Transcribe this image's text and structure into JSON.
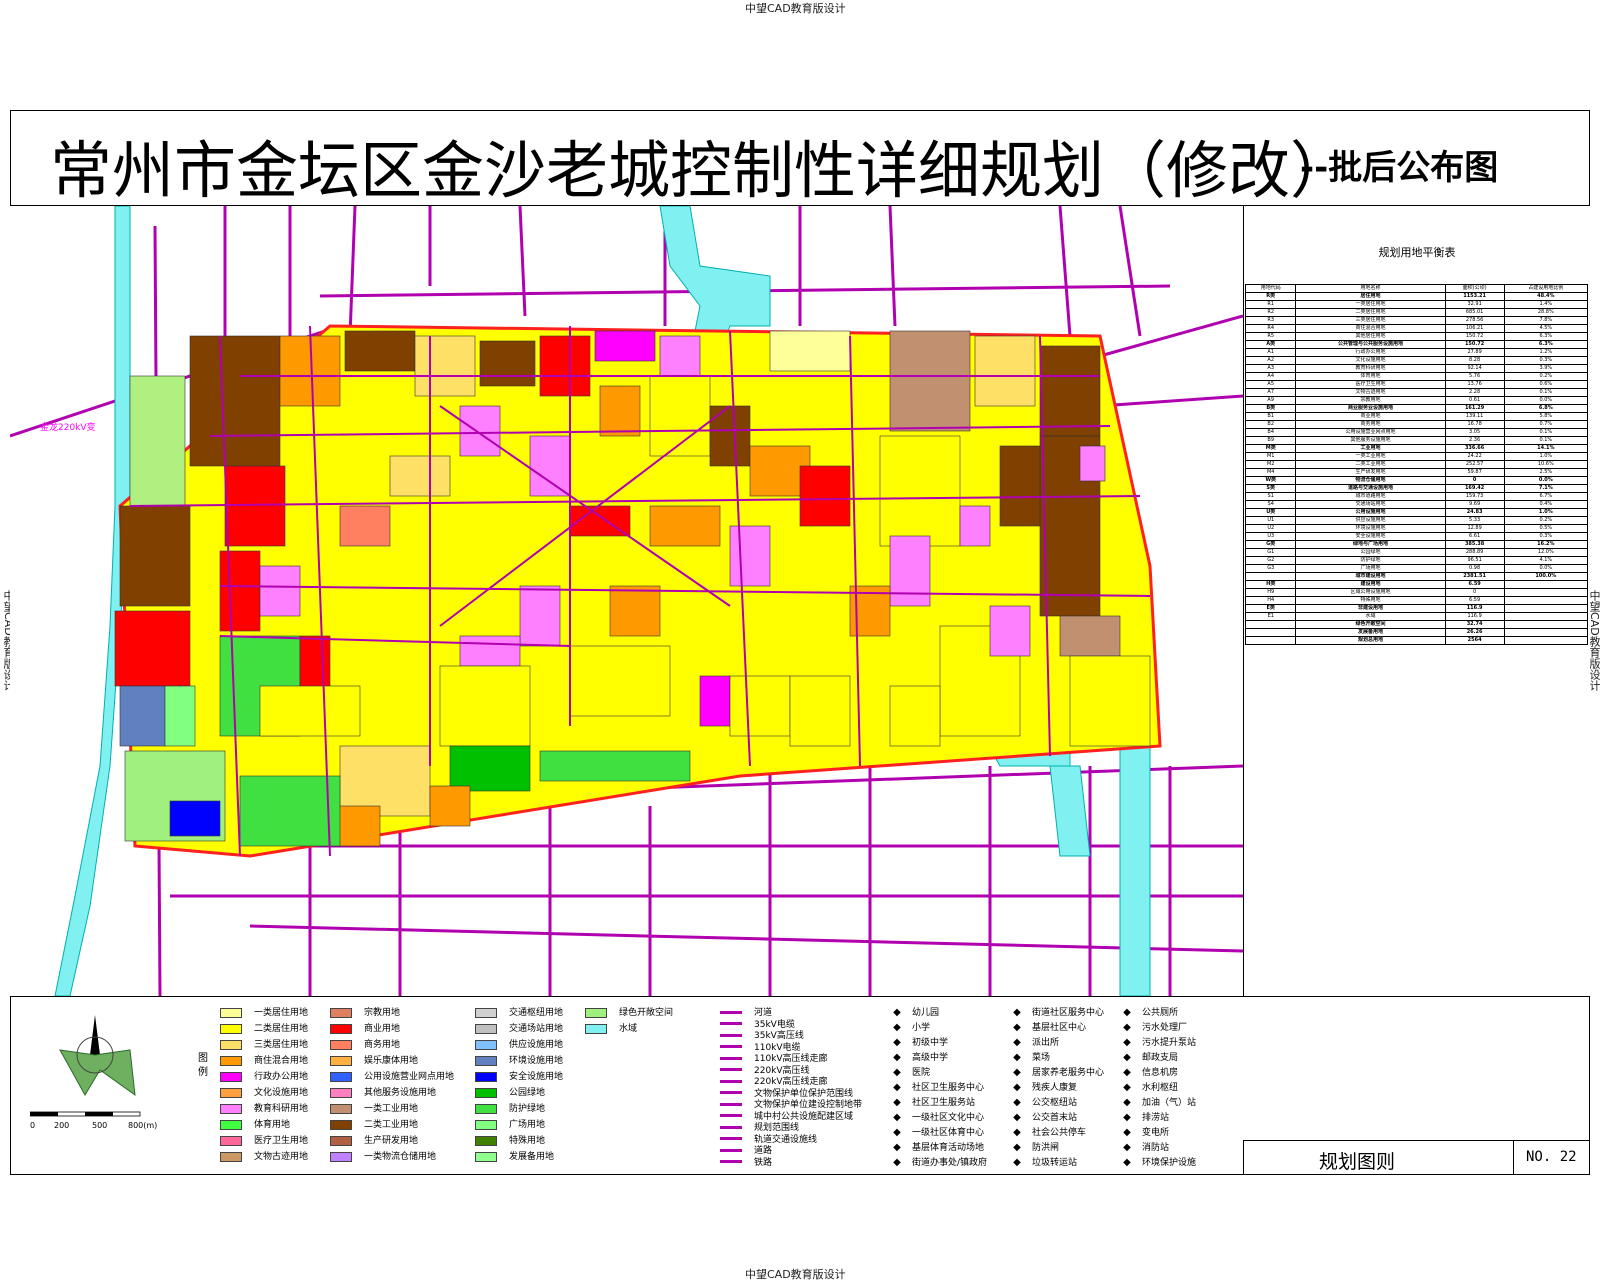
{
  "watermark": "中望CAD教育版设计",
  "title": "常州市金坛区金沙老城控制性详细规划（修改）",
  "title_suffix": "--批后公布图",
  "map_labels": {
    "substation": "金龙220kV变"
  },
  "land_table": {
    "title": "规划用地平衡表",
    "header": [
      "用地代码",
      "用地名称",
      "面积(公顷)",
      "占建设用地比例"
    ],
    "rows": [
      [
        "R类",
        "居住用地",
        "1153.21",
        "48.4%"
      ],
      [
        "R1",
        "一类居住用地",
        "32.91",
        "1.4%"
      ],
      [
        "R2",
        "二类居住用地",
        "685.01",
        "28.8%"
      ],
      [
        "R3",
        "三类居住用地",
        "278.56",
        "7.8%"
      ],
      [
        "R4",
        "商住混合用地",
        "106.21",
        "4.5%"
      ],
      [
        "R5",
        "其他居住用地",
        "150.72",
        "6.3%"
      ],
      [
        "A类",
        "公共管理与公共服务设施用地",
        "150.72",
        "6.3%"
      ],
      [
        "A1",
        "行政办公用地",
        "27.89",
        "1.2%"
      ],
      [
        "A2",
        "文化设施用地",
        "8.28",
        "0.3%"
      ],
      [
        "A3",
        "教育科研用地",
        "92.14",
        "3.9%"
      ],
      [
        "A4",
        "体育用地",
        "5.76",
        "0.2%"
      ],
      [
        "A5",
        "医疗卫生用地",
        "13.76",
        "0.6%"
      ],
      [
        "A7",
        "文物古迹用地",
        "2.28",
        "0.1%"
      ],
      [
        "A9",
        "宗教用地",
        "0.61",
        "0.0%"
      ],
      [
        "B类",
        "商业服务业设施用地",
        "161.29",
        "6.8%"
      ],
      [
        "B1",
        "商业用地",
        "139.11",
        "5.8%"
      ],
      [
        "B2",
        "商务用地",
        "16.78",
        "0.7%"
      ],
      [
        "B4",
        "公用设施营业网点用地",
        "3.05",
        "0.1%"
      ],
      [
        "B9",
        "其他服务设施用地",
        "2.36",
        "0.1%"
      ],
      [
        "M类",
        "工业用地",
        "336.66",
        "14.1%"
      ],
      [
        "M1",
        "一类工业用地",
        "24.22",
        "1.0%"
      ],
      [
        "M2",
        "二类工业用地",
        "252.57",
        "10.6%"
      ],
      [
        "M4",
        "生产研发用地",
        "59.87",
        "2.5%"
      ],
      [
        "W类",
        "物流仓储用地",
        "0",
        "0.0%"
      ],
      [
        "S类",
        "道路与交通设施用地",
        "169.42",
        "7.1%"
      ],
      [
        "S1",
        "城市道路用地",
        "159.73",
        "6.7%"
      ],
      [
        "S4",
        "交通场站用地",
        "9.69",
        "0.4%"
      ],
      [
        "U类",
        "公用设施用地",
        "24.83",
        "1.0%"
      ],
      [
        "U1",
        "供应设施用地",
        "5.33",
        "0.2%"
      ],
      [
        "U2",
        "环境设施用地",
        "12.89",
        "0.5%"
      ],
      [
        "U3",
        "安全设施用地",
        "6.61",
        "0.3%"
      ],
      [
        "G类",
        "绿地与广场用地",
        "385.38",
        "16.2%"
      ],
      [
        "G1",
        "公园绿地",
        "288.89",
        "12.0%"
      ],
      [
        "G2",
        "防护绿地",
        "96.51",
        "4.1%"
      ],
      [
        "G3",
        "广场用地",
        "0.98",
        "0.0%"
      ],
      [
        "",
        "城市建设用地",
        "2381.51",
        "100.0%"
      ],
      [
        "H类",
        "建设用地",
        "6.59",
        ""
      ],
      [
        "H9",
        "区域公用设施用地",
        "0",
        ""
      ],
      [
        "H4",
        "特殊用地",
        "6.59",
        ""
      ],
      [
        "E类",
        "非建设用地",
        "116.9",
        ""
      ],
      [
        "E1",
        "水域",
        "116.9",
        ""
      ],
      [
        "",
        "绿色开敞空间",
        "32.74",
        ""
      ],
      [
        "",
        "发展备用地",
        "26.26",
        ""
      ],
      [
        "",
        "规划总用地",
        "2564",
        ""
      ]
    ]
  },
  "legend": {
    "label": "图例",
    "land_uses": [
      {
        "name": "一类居住用地",
        "color": "#ffff99"
      },
      {
        "name": "二类居住用地",
        "color": "#ffff00"
      },
      {
        "name": "三类居住用地",
        "color": "#ffe066"
      },
      {
        "name": "商住混合用地",
        "color": "#ff9900"
      },
      {
        "name": "行政办公用地",
        "color": "#ff00ff"
      },
      {
        "name": "文化设施用地",
        "color": "#ff9f40"
      },
      {
        "name": "教育科研用地",
        "color": "#ff80ff"
      },
      {
        "name": "体育用地",
        "color": "#40ff40"
      },
      {
        "name": "医疗卫生用地",
        "color": "#ff6699"
      },
      {
        "name": "文物古迹用地",
        "color": "#cc9966"
      },
      {
        "name": "宗教用地",
        "color": "#e08060"
      },
      {
        "name": "商业用地",
        "color": "#ff0000"
      },
      {
        "name": "商务用地",
        "color": "#ff8060"
      },
      {
        "name": "娱乐康体用地",
        "color": "#ffb040"
      },
      {
        "name": "公用设施营业网点用地",
        "color": "#3060ff"
      },
      {
        "name": "其他服务设施用地",
        "color": "#ff80c0"
      },
      {
        "name": "一类工业用地",
        "color": "#c09070"
      },
      {
        "name": "二类工业用地",
        "color": "#804000"
      },
      {
        "name": "生产研发用地",
        "color": "#b06040"
      },
      {
        "name": "一类物流仓储用地",
        "color": "#c080ff"
      },
      {
        "name": "交通枢纽用地",
        "color": "#d0d0d0"
      },
      {
        "name": "交通场站用地",
        "color": "#c0c0c0"
      },
      {
        "name": "供应设施用地",
        "color": "#80c0ff"
      },
      {
        "name": "环境设施用地",
        "color": "#6080c0"
      },
      {
        "name": "安全设施用地",
        "color": "#0000ff"
      },
      {
        "name": "公园绿地",
        "color": "#00c000"
      },
      {
        "name": "防护绿地",
        "color": "#40e040"
      },
      {
        "name": "广场用地",
        "color": "#80ff80"
      },
      {
        "name": "特殊用地",
        "color": "#408000"
      },
      {
        "name": "发展备用地",
        "color": "#90ff90"
      },
      {
        "name": "绿色开敞空间",
        "color": "#a0f080"
      },
      {
        "name": "水域",
        "color": "#80f0f0"
      }
    ],
    "lines": [
      "河道",
      "35kV电缆",
      "35kV高压线",
      "110kV电缆",
      "110kV高压线走廊",
      "220kV高压线",
      "220kV高压线走廊",
      "文物保护单位保护范围线",
      "文物保护单位建设控制地带",
      "城中村公共设施配建区域",
      "规划范围线",
      "轨道交通设施线",
      "道路",
      "铁路"
    ],
    "facilities_a": [
      "幼儿园",
      "小学",
      "初级中学",
      "高级中学",
      "医院",
      "社区卫生服务中心",
      "社区卫生服务站",
      "一级社区文化中心",
      "一级社区体育中心",
      "基层体育活动场地",
      "街道办事处/镇政府"
    ],
    "facilities_b": [
      "街道社区服务中心",
      "基层社区中心",
      "派出所",
      "菜场",
      "居家养老服务中心",
      "残疾人康复",
      "公交枢纽站",
      "公交首末站",
      "社会公共停车",
      "防洪闸",
      "垃圾转运站"
    ],
    "facilities_c": [
      "公共厕所",
      "污水处理厂",
      "污水提升泵站",
      "邮政支局",
      "信息机房",
      "水利枢纽",
      "加油（气）站",
      "排涝站",
      "变电所",
      "消防站",
      "环境保护设施"
    ],
    "scale_ticks": [
      "0",
      "200",
      "500",
      "800(m)"
    ]
  },
  "footer": {
    "tuze": "规划图则",
    "sheet_no": "NO. 22"
  }
}
